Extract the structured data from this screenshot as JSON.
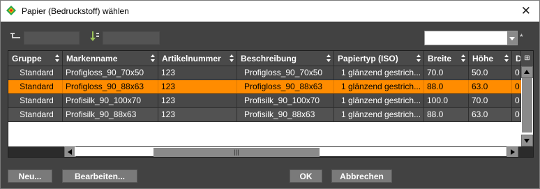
{
  "window": {
    "title": "Papier (Bedruckstoff) wählen",
    "close_glyph": "✕",
    "icon": "app-logo-icon"
  },
  "filters": {
    "left_icon": "tree-filter-icon",
    "left_value": "",
    "mid_icon": "sort-filter-icon",
    "mid_value": "",
    "combo_value": "",
    "required_marker": "*"
  },
  "table": {
    "columns": [
      "Gruppe",
      "Markenname",
      "Artikelnummer",
      "Beschreibung",
      "Papiertyp (ISO)",
      "Breite",
      "Höhe",
      "D"
    ],
    "rows": [
      [
        "Standard",
        "Profigloss_90_70x50",
        "123",
        "Profigloss_90_70x50",
        "1 glänzend gestrich...",
        "70.0",
        "50.0",
        "0"
      ],
      [
        "Standard",
        "Profigloss_90_88x63",
        "123",
        "Profigloss_90_88x63",
        "1 glänzend gestrich...",
        "88.0",
        "63.0",
        "0"
      ],
      [
        "Standard",
        "Profisilk_90_100x70",
        "123",
        "Profisilk_90_100x70",
        "1 glänzend gestrich...",
        "100.0",
        "70.0",
        "0"
      ],
      [
        "Standard",
        "Profisilk_90_88x63",
        "123",
        "Profisilk_90_88x63",
        "1 glänzend gestrich...",
        "88.0",
        "63.0",
        "0"
      ]
    ],
    "selected_row": 1
  },
  "buttons": {
    "new": "Neu...",
    "edit": "Bearbeiten...",
    "ok": "OK",
    "cancel": "Abbrechen"
  },
  "colors": {
    "selection": "#ff8c00",
    "row_alt": "#525252",
    "row": "#484848",
    "background": "#424242"
  }
}
